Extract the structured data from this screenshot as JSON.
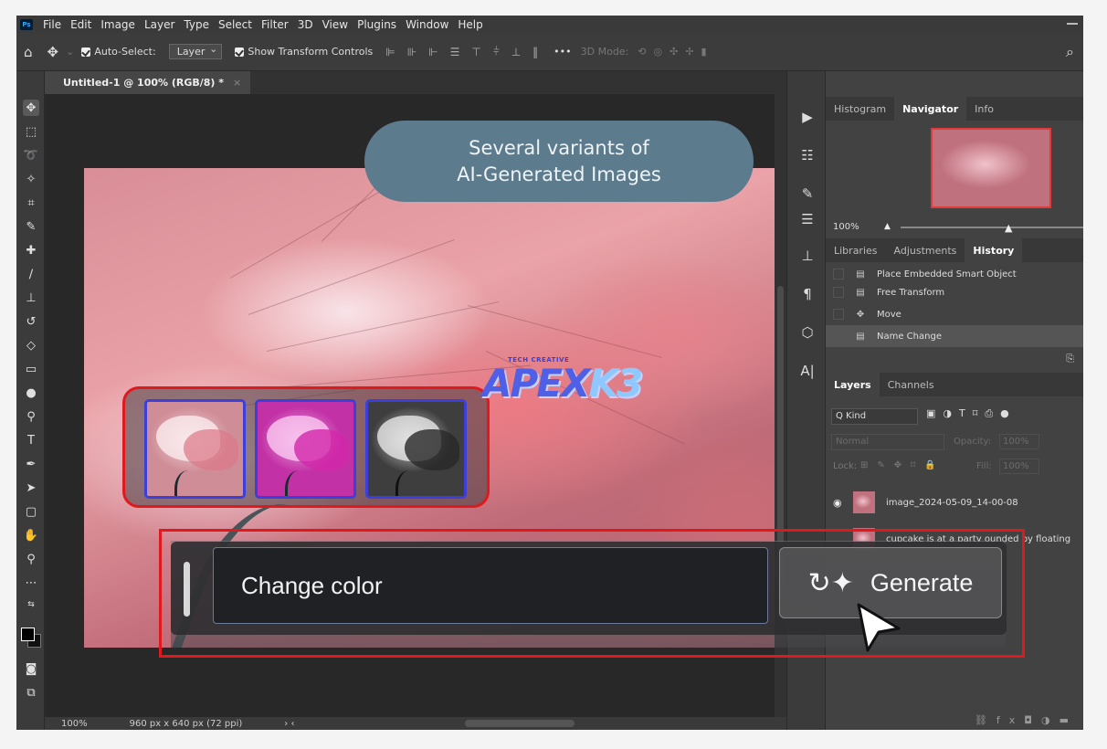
{
  "menu": [
    "File",
    "Edit",
    "Image",
    "Layer",
    "Type",
    "Select",
    "Filter",
    "3D",
    "View",
    "Plugins",
    "Window",
    "Help"
  ],
  "app_badge": "Ps",
  "options": {
    "auto_select_label": "Auto-Select:",
    "auto_select_value": "Layer",
    "show_transform_label": "Show Transform Controls",
    "more": "•••",
    "mode_label": "3D Mode:"
  },
  "document": {
    "tab_title": "Untitled-1 @ 100% (RGB/8) *",
    "tab_close": "×",
    "zoom": "100%",
    "size_info": "960 px x 640 px (72 ppi)",
    "status_arrows": "›   ‹"
  },
  "callout": {
    "line1": "Several variants of",
    "line2": "AI-Generated Images"
  },
  "watermark": {
    "small": "TECH CREATIVE",
    "big_a": "APEX",
    "big_b": "K3"
  },
  "generate_bar": {
    "prompt_value": "Change color",
    "button_label": "Generate",
    "button_icon": "generative-sparkle-icon"
  },
  "panels": {
    "top_tabs": [
      "Histogram",
      "Navigator",
      "Info"
    ],
    "top_active": 1,
    "zoom": "100%",
    "mid_tabs": [
      "Libraries",
      "Adjustments",
      "History"
    ],
    "mid_active": 2,
    "history": [
      {
        "label": "Place Embedded Smart Object",
        "icon": "doc-icon"
      },
      {
        "label": "Free Transform",
        "icon": "doc-icon"
      },
      {
        "label": "Move",
        "icon": "move-icon"
      },
      {
        "label": "Name Change",
        "icon": "doc-icon",
        "selected": true
      }
    ],
    "layer_tabs": [
      "Layers",
      "Channels"
    ],
    "layer_active": 0,
    "kind_label": "Q Kind",
    "blend_mode": "Normal",
    "opacity_label": "Opacity:",
    "opacity_value": "100%",
    "lock_label": "Lock:",
    "fill_label": "Fill:",
    "fill_value": "100%",
    "layers": [
      {
        "name": "image_2024-05-09_14-00-08",
        "visible": true
      },
      {
        "name": "cupcake is at a party   ounded by floating",
        "visible": false
      }
    ]
  }
}
